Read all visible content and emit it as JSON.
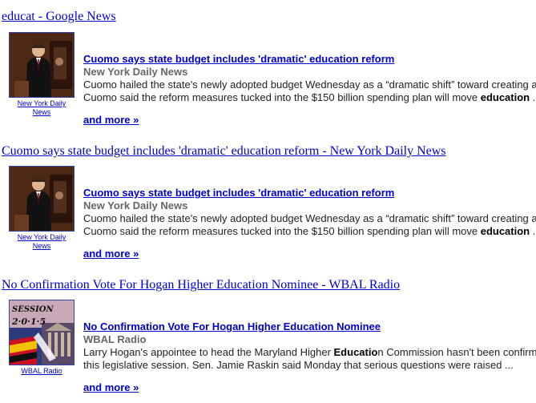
{
  "feeds": [
    {
      "title": "educat - Google News",
      "headline": "Cuomo says state budget includes 'dramatic' education reform",
      "source": "New York Daily News",
      "thumb_caption_line1": "New York Daily",
      "thumb_caption_line2": "News",
      "snippet_line1": "Cuomo hailed the state's newly adopted budget Wednesday as a “dramatic shift” toward creating a",
      "snippet_line2_before": "Cuomo said the reform measures tucked into the $150 billion spending plan will move ",
      "snippet_line2_bold": "education",
      "snippet_line2_after": " ...",
      "more_label": "and more »",
      "thumb_icon": "governor-at-podium-photo"
    },
    {
      "title": "Cuomo says state budget includes 'dramatic' education reform - New York Daily News",
      "headline": "Cuomo says state budget includes 'dramatic' education reform",
      "source": "New York Daily News",
      "thumb_caption_line1": "New York Daily",
      "thumb_caption_line2": "News",
      "snippet_line1": "Cuomo hailed the state's newly adopted budget Wednesday as a “dramatic shift” toward creating a",
      "snippet_line2_before": "Cuomo said the reform measures tucked into the $150 billion spending plan will move ",
      "snippet_line2_bold": "education",
      "snippet_line2_after": " ...",
      "more_label": "and more »",
      "thumb_icon": "governor-at-podium-photo"
    },
    {
      "title": "No Confirmation Vote For Hogan Higher Education Nominee - WBAL Radio",
      "headline": "No Confirmation Vote For Hogan Higher Education Nominee",
      "source": "WBAL Radio",
      "thumb_caption_line1": "WBAL Radio",
      "snippet_line1_before": "Larry Hogan's appointee to head the Maryland Higher ",
      "snippet_line1_bold": "Educatio",
      "snippet_line1_after": "n Commission hasn't been confirm",
      "snippet_line2": "this legislative session. Sen. Jamie Raskin said Monday that serious questions were raised ...",
      "more_label": "and more »",
      "thumb_icon": "session-2015-graphic",
      "thumb_graphic_text_1": "SESSION",
      "thumb_graphic_text_2": "2·0·1·5"
    }
  ],
  "colors": {
    "link": "#0000cc",
    "source": "#666666",
    "text": "#222222"
  }
}
